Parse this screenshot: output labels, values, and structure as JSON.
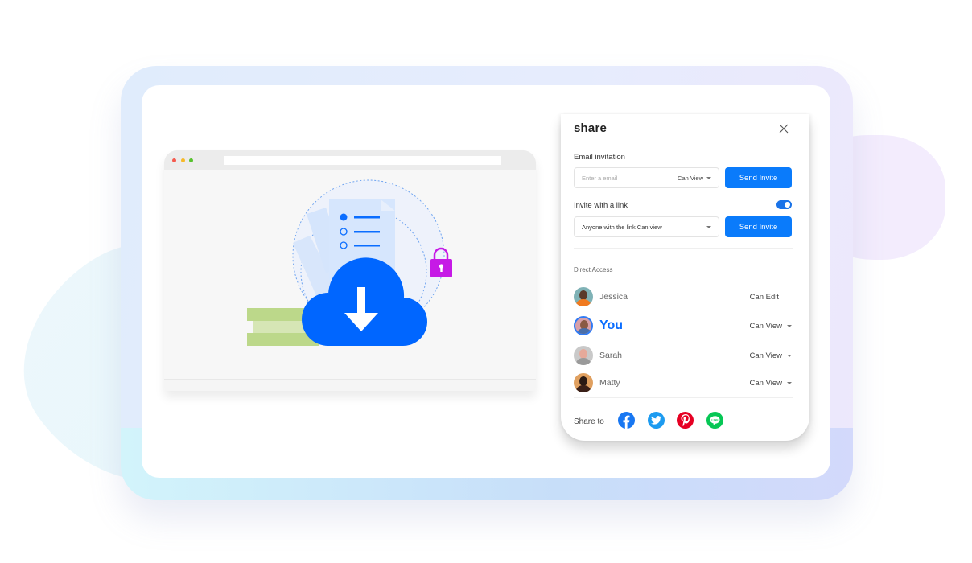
{
  "share_panel": {
    "title": "share",
    "email_invitation": {
      "label": "Email invitation",
      "input_placeholder": "Enter a email",
      "permission": "Can View",
      "button": "Send Invite"
    },
    "link_invitation": {
      "label": "Invite with a link",
      "toggle_on": true,
      "selected_option": "Anyone with the link Can view",
      "button": "Send Invite"
    },
    "direct_access": {
      "label": "Direct Access",
      "people": [
        {
          "name": "Jessica",
          "permission": "Can Edit",
          "has_dropdown": false
        },
        {
          "name": "You",
          "permission": "Can View",
          "has_dropdown": true
        },
        {
          "name": "Sarah",
          "permission": "Can View",
          "has_dropdown": true
        },
        {
          "name": "Matty",
          "permission": "Can View",
          "has_dropdown": true
        }
      ]
    },
    "share_to": {
      "label": "Share to",
      "networks": [
        {
          "name": "Facebook",
          "icon": "facebook-icon",
          "color": "#1877f2"
        },
        {
          "name": "Twitter",
          "icon": "twitter-icon",
          "color": "#1d9bf0"
        },
        {
          "name": "Pinterest",
          "icon": "pinterest-icon",
          "color": "#e60023"
        },
        {
          "name": "LINE",
          "icon": "line-icon",
          "color": "#06c755"
        }
      ]
    }
  },
  "colors": {
    "accent": "#0a7bfb",
    "lock": "#c61ae6",
    "cloud": "#0066ff",
    "books": "#bcd88a"
  }
}
